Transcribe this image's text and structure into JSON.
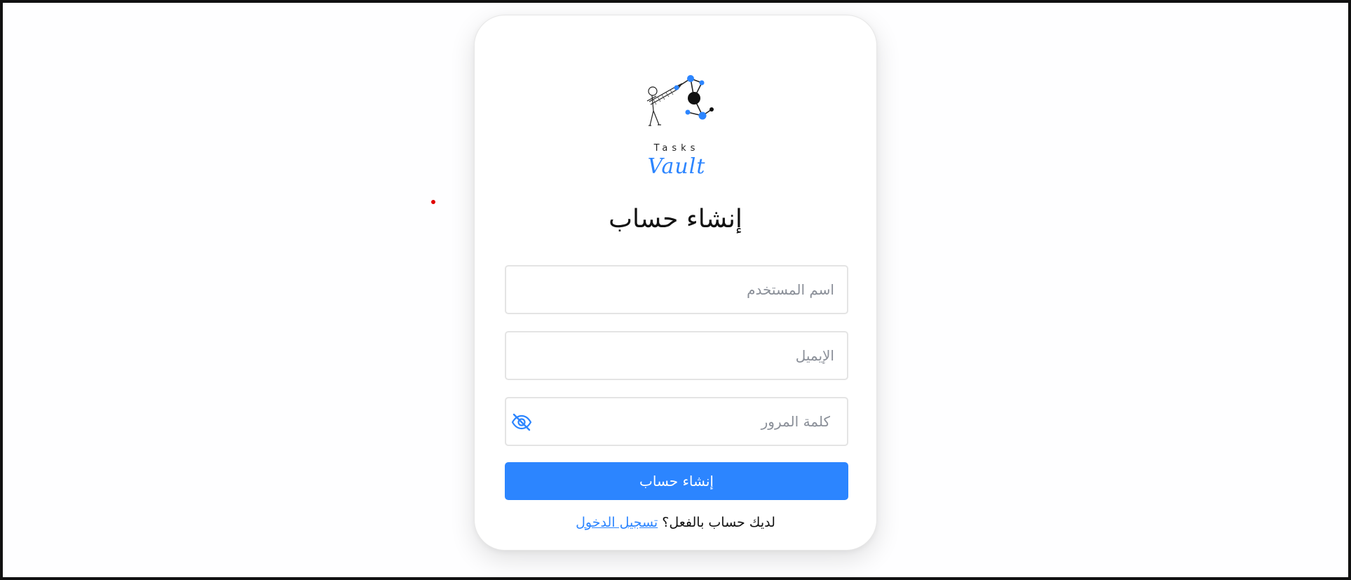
{
  "colors": {
    "accent": "#2c85ff",
    "frame_border": "#111111",
    "red_dot": "#e00000"
  },
  "logo": {
    "line1": "Tasks",
    "line2": "Vault",
    "illustration": "stick-figure-with-network-icon"
  },
  "form": {
    "title": "إنشاء حساب",
    "username_placeholder": "اسم المستخدم",
    "email_placeholder": "الإيميل",
    "password_placeholder": "كلمة المرور",
    "password_toggle_icon": "eye-slash-icon",
    "submit_label": "إنشاء حساب"
  },
  "footer": {
    "prompt": "لديك حساب بالفعل؟ ",
    "login_link": "تسجيل الدخول"
  }
}
